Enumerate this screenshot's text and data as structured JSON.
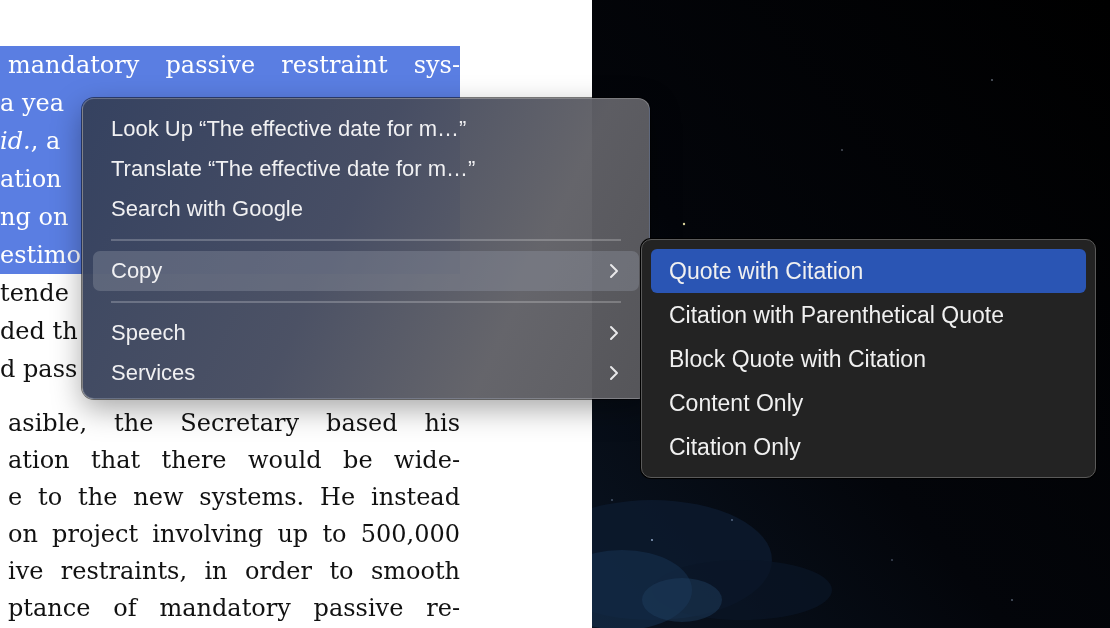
{
  "document": {
    "lines_beside_menu": [
      {
        "text": "mandatory passive restraint sys-",
        "selected": true,
        "kind": "full"
      },
      {
        "text": "a yea",
        "selected": true,
        "kind": "partial"
      },
      {
        "text": "*id.*, a",
        "selected": true,
        "kind": "partial"
      },
      {
        "text": "ation",
        "selected": true,
        "kind": "partial"
      },
      {
        "text": "ng on",
        "selected": true,
        "kind": "partial"
      },
      {
        "text": "estimo",
        "selected": true,
        "kind": "partial"
      },
      {
        "text": "tende",
        "selected": false,
        "kind": "partial"
      },
      {
        "text": "ded th",
        "selected": false,
        "kind": "partial"
      },
      {
        "text": "d pass",
        "selected": false,
        "kind": "partial"
      }
    ],
    "lines_below_menu": [
      {
        "text": "asible, the Secretary based his",
        "selected": false,
        "kind": "full"
      },
      {
        "text": "ation that there would be wide-",
        "selected": false,
        "kind": "full"
      },
      {
        "text": "e to the new systems. He instead",
        "selected": false,
        "kind": "full"
      },
      {
        "text": "on project involving up to 500,000",
        "selected": false,
        "kind": "full"
      },
      {
        "text": "ive restraints, in order to smooth",
        "selected": false,
        "kind": "full"
      },
      {
        "text": "ptance of mandatory passive re-",
        "selected": false,
        "kind": "full"
      }
    ]
  },
  "context_menu": {
    "items": [
      {
        "kind": "item",
        "label": "Look Up “The effective date for m…”",
        "selected": false,
        "has_submenu": false
      },
      {
        "kind": "item",
        "label": "Translate “The effective date for m…”",
        "selected": false,
        "has_submenu": false
      },
      {
        "kind": "item",
        "label": "Search with Google",
        "selected": false,
        "has_submenu": false
      },
      {
        "kind": "separator"
      },
      {
        "kind": "item",
        "label": "Copy",
        "selected": true,
        "has_submenu": true
      },
      {
        "kind": "separator"
      },
      {
        "kind": "item",
        "label": "Speech",
        "selected": false,
        "has_submenu": true
      },
      {
        "kind": "item",
        "label": "Services",
        "selected": false,
        "has_submenu": true
      }
    ]
  },
  "submenu": {
    "items": [
      {
        "label": "Quote with Citation",
        "selected": true
      },
      {
        "label": "Citation with Parenthetical Quote",
        "selected": false
      },
      {
        "label": "Block Quote with Citation",
        "selected": false
      },
      {
        "label": "Content Only",
        "selected": false
      },
      {
        "label": "Citation Only",
        "selected": false
      }
    ]
  }
}
